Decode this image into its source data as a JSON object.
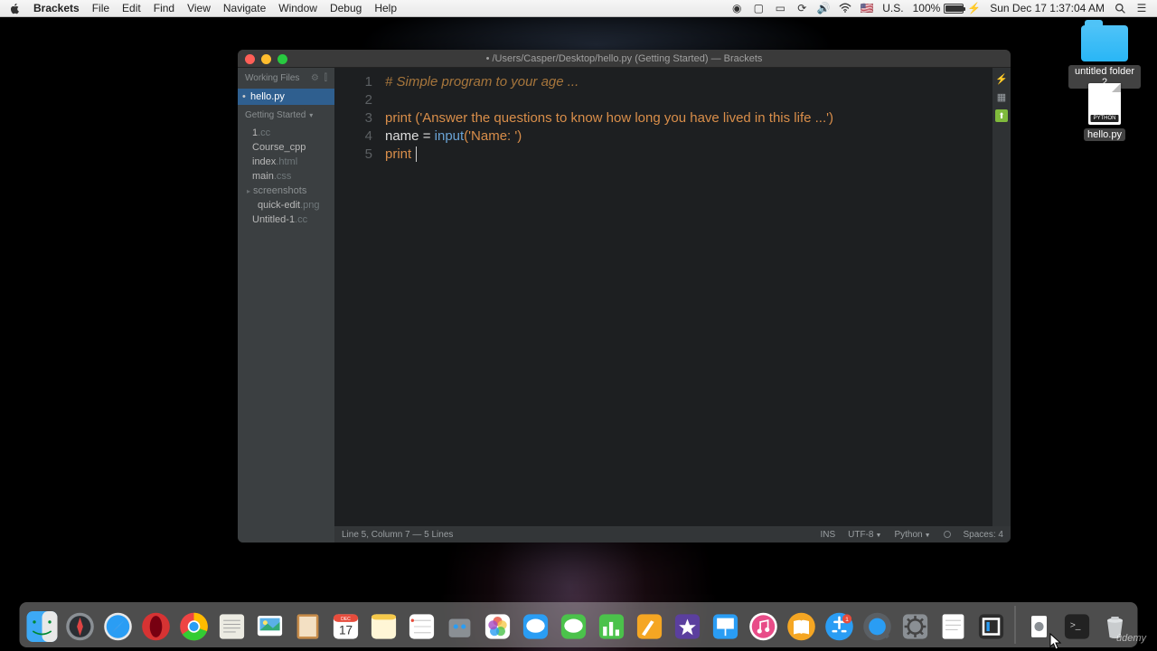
{
  "menubar": {
    "app": "Brackets",
    "items": [
      "File",
      "Edit",
      "Find",
      "View",
      "Navigate",
      "Window",
      "Debug",
      "Help"
    ],
    "locale": "U.S.",
    "battery": "100%",
    "charging_icon": "⚡",
    "datetime": "Sun Dec 17  1:37:04 AM"
  },
  "desktop_items": {
    "folder": {
      "label": "untitled folder 2"
    },
    "file": {
      "label": "hello.py",
      "badge": "PYTHON"
    }
  },
  "window": {
    "title": "• /Users/Casper/Desktop/hello.py (Getting Started) — Brackets"
  },
  "sidebar": {
    "working_header": "Working Files",
    "working_items": [
      "hello.py"
    ],
    "project_header": "Getting Started",
    "tree": [
      {
        "name": "1",
        "ext": ".cc"
      },
      {
        "name": "Course_cpp",
        "ext": ""
      },
      {
        "name": "index",
        "ext": ".html"
      },
      {
        "name": "main",
        "ext": ".css"
      }
    ],
    "folder": "screenshots",
    "subtree": [
      {
        "name": "quick-edit",
        "ext": ".png"
      }
    ],
    "tail": [
      {
        "name": "Untitled-1",
        "ext": ".cc"
      }
    ]
  },
  "code": {
    "lines": [
      "1",
      "2",
      "3",
      "4",
      "5"
    ],
    "l1_comment": "# Simple program to your age ...",
    "l3_kw": "print",
    "l3_str": " ('Answer the questions to know how long you have lived in this life ...')",
    "l4_name": "name",
    "l4_eq": " = ",
    "l4_fn": "input",
    "l4_args": "('Name: ')",
    "l5_kw": "print"
  },
  "status": {
    "left": "Line 5, Column 7 — 5 Lines",
    "ins": "INS",
    "enc": "UTF-8",
    "lang": "Python",
    "spaces": "Spaces: 4"
  },
  "watermark": "ûdemy",
  "colors": {
    "accent": "#2f5f8f",
    "comment": "#a7763c",
    "keyword": "#d98e4a",
    "func": "#6aa3d5"
  }
}
